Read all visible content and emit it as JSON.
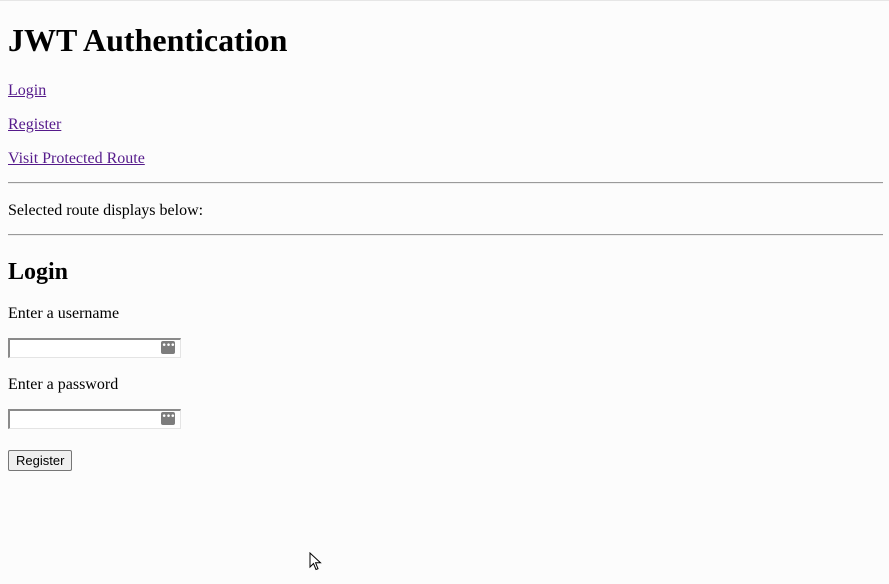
{
  "header": {
    "title": "JWT Authentication"
  },
  "nav": {
    "links": [
      {
        "label": "Login"
      },
      {
        "label": "Register"
      },
      {
        "label": "Visit Protected Route"
      }
    ]
  },
  "notice": "Selected route displays below:",
  "form": {
    "heading": "Login",
    "username_label": "Enter a username",
    "username_value": "",
    "password_label": "Enter a password",
    "password_value": "",
    "submit_label": "Register",
    "password_manager_icon": "password-key-icon"
  },
  "colors": {
    "link": "#551a8b",
    "background": "#fcfcfc"
  }
}
